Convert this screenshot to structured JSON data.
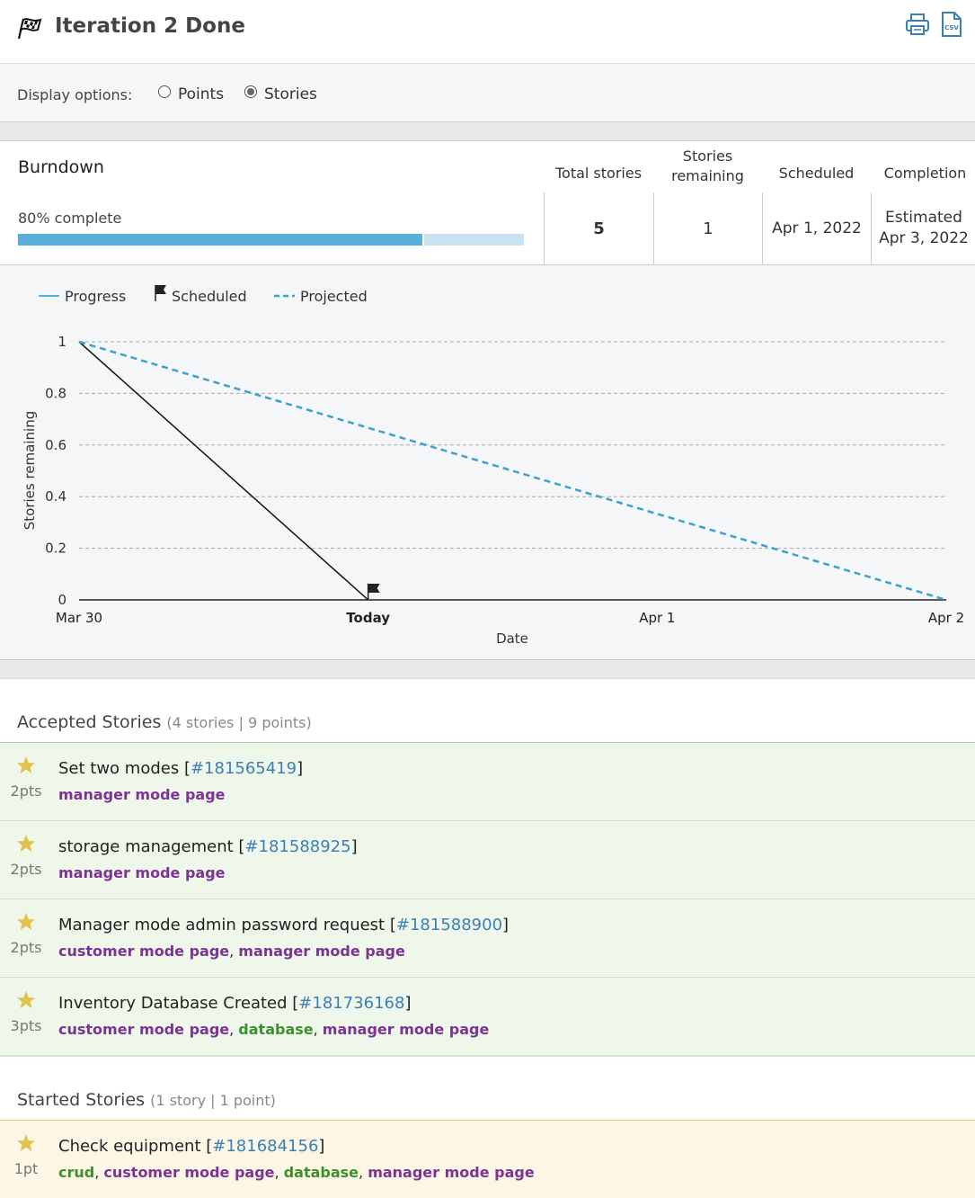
{
  "page": {
    "title": "Iteration 2 Done"
  },
  "toolbar": {
    "print_icon": "printer-icon",
    "csv_icon": "csv-file-icon"
  },
  "display_options": {
    "label": "Display options:",
    "options": [
      {
        "label": "Points",
        "checked": false
      },
      {
        "label": "Stories",
        "checked": true
      }
    ]
  },
  "burndown": {
    "title": "Burndown",
    "percent_text": "80% complete",
    "percent_value": 0.8,
    "columns": [
      {
        "header": "Total stories",
        "header_line1": "",
        "header_line2": "Total stories",
        "value": "5",
        "value2": ""
      },
      {
        "header": "Stories remaining",
        "header_line1": "Stories",
        "header_line2": "remaining",
        "value": "1",
        "value2": ""
      },
      {
        "header": "Scheduled",
        "header_line1": "",
        "header_line2": "Scheduled",
        "value": "Apr 1, 2022",
        "value2": ""
      },
      {
        "header": "Completion",
        "header_line1": "",
        "header_line2": "Completion",
        "value": "Estimated",
        "value2": "Apr 3, 2022"
      }
    ]
  },
  "chart_data": {
    "type": "line",
    "title": "",
    "xlabel": "Date",
    "ylabel": "Stories remaining",
    "x_ticks": [
      "Mar 30",
      "Today",
      "Apr 1",
      "Apr 2"
    ],
    "y_ticks": [
      "0",
      "0.2",
      "0.4",
      "0.6",
      "0.8",
      "1"
    ],
    "ylim": [
      0,
      1
    ],
    "grid": true,
    "legend_position": "top-left",
    "legend": [
      {
        "name": "Progress",
        "style": "solid",
        "color": "#5aafdc"
      },
      {
        "name": "Scheduled",
        "style": "flag-marker",
        "color": "#222222"
      },
      {
        "name": "Projected",
        "style": "dashed",
        "color": "#3ea0cc"
      }
    ],
    "series": [
      {
        "name": "Progress",
        "x": [
          "Mar 30",
          "Today"
        ],
        "values": [
          1,
          0
        ],
        "color": "#111111"
      },
      {
        "name": "Projected",
        "x": [
          "Mar 30",
          "Apr 2"
        ],
        "values": [
          1,
          0
        ],
        "color": "#3ea0cc"
      }
    ],
    "scheduled_marker_x": "Today"
  },
  "accepted": {
    "title": "Accepted Stories",
    "meta": "(4 stories | 9 points)",
    "stories": [
      {
        "title": "Set two modes",
        "id": "#181565419",
        "points": "2pts",
        "labels": [
          {
            "text": "manager mode page",
            "color": "purple"
          }
        ]
      },
      {
        "title": "storage management",
        "id": "#181588925",
        "points": "2pts",
        "labels": [
          {
            "text": "manager mode page",
            "color": "purple"
          }
        ]
      },
      {
        "title": "Manager mode admin password request",
        "id": "#181588900",
        "points": "2pts",
        "labels": [
          {
            "text": "customer mode page",
            "color": "purple"
          },
          {
            "text": "manager mode page",
            "color": "purple"
          }
        ]
      },
      {
        "title": "Inventory Database Created",
        "id": "#181736168",
        "points": "3pts",
        "labels": [
          {
            "text": "customer mode page",
            "color": "purple"
          },
          {
            "text": "database",
            "color": "green"
          },
          {
            "text": "manager mode page",
            "color": "purple"
          }
        ]
      }
    ]
  },
  "started": {
    "title": "Started Stories",
    "meta": "(1 story | 1 point)",
    "stories": [
      {
        "title": "Check equipment",
        "id": "#181684156",
        "points": "1pt",
        "labels": [
          {
            "text": "crud",
            "color": "green"
          },
          {
            "text": "customer mode page",
            "color": "purple"
          },
          {
            "text": "database",
            "color": "green"
          },
          {
            "text": "manager mode page",
            "color": "purple"
          }
        ]
      }
    ]
  }
}
